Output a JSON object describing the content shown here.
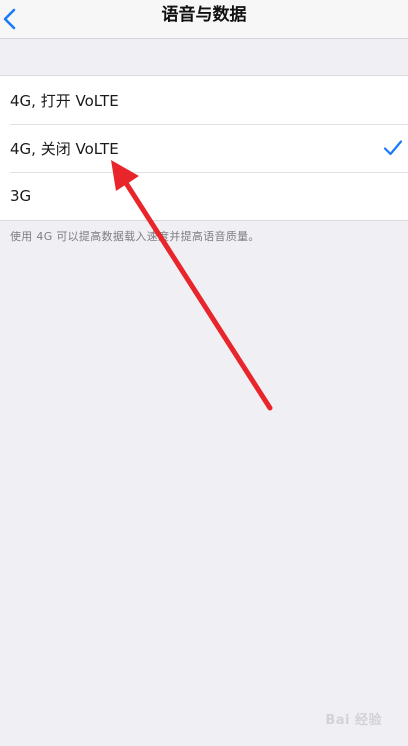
{
  "nav": {
    "title": "语音与数据",
    "back_icon": "chevron-left-icon"
  },
  "options": [
    {
      "label": "4G, 打开 VoLTE",
      "selected": false
    },
    {
      "label": "4G, 关闭 VoLTE",
      "selected": true
    },
    {
      "label": "3G",
      "selected": false
    }
  ],
  "footer_note": "使用 4G 可以提高数据载入速度并提高语音质量。",
  "watermark": "Bai 经验",
  "colors": {
    "accent": "#1a7cf5",
    "arrow": "#e8252a",
    "background": "#efeff4"
  }
}
